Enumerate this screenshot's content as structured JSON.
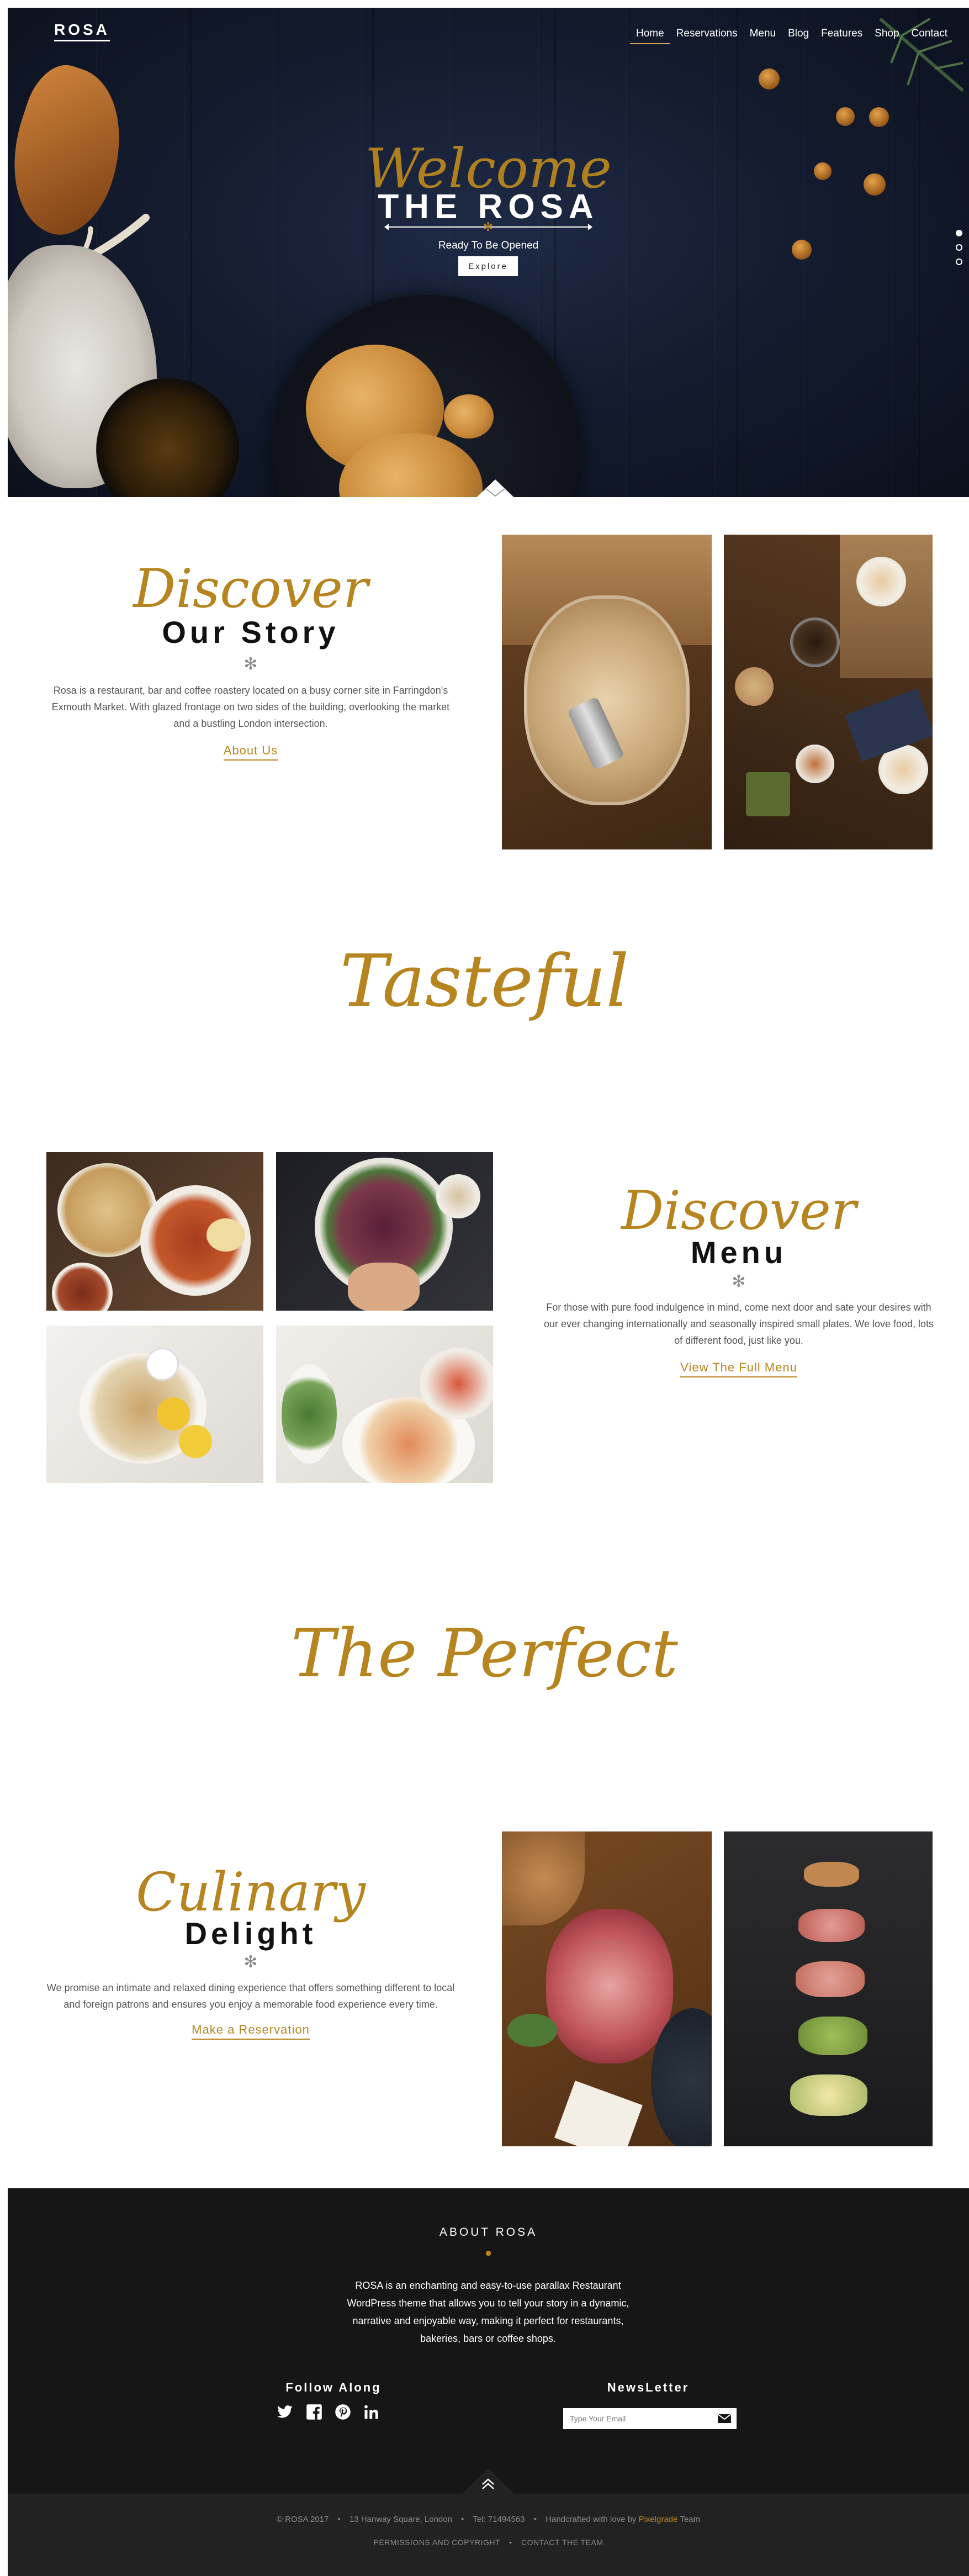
{
  "header": {
    "logo": "ROSA",
    "nav": [
      {
        "label": "Home",
        "active": true
      },
      {
        "label": "Reservations"
      },
      {
        "label": "Menu"
      },
      {
        "label": "Blog"
      },
      {
        "label": "Features"
      },
      {
        "label": "Shop"
      },
      {
        "label": "Contact"
      }
    ]
  },
  "hero": {
    "script": "Welcome",
    "title": "THE ROSA",
    "tagline": "Ready To Be Opened",
    "button": "Explore",
    "slides": 3,
    "active_slide": 1
  },
  "story": {
    "script": "Discover",
    "heading": "Our Story",
    "star": "✻",
    "text": "Rosa is a restaurant, bar and coffee roastery located on a busy corner site in Farringdon's Exmouth Market. With glazed frontage on two sides of the building, overlooking the market and a bustling London intersection.",
    "link": "About Us"
  },
  "tasteful": {
    "script": "Tasteful"
  },
  "menu": {
    "script": "Discover",
    "heading": "Menu",
    "star": "✻",
    "text": "For those with pure food indulgence in mind, come next door and sate your desires with our ever changing internationally and seasonally inspired small plates. We love food, lots of different food, just like you.",
    "link": "View The Full Menu"
  },
  "perfect": {
    "script": "The Perfect"
  },
  "delight": {
    "script": "Culinary",
    "heading": "Delight",
    "star": "✻",
    "text": "We promise an intimate and relaxed dining experience that offers something different to local and foreign patrons and ensures you enjoy a memorable food experience every time.",
    "link": "Make a Reservation"
  },
  "footer": {
    "about_title": "ABOUT ROSA",
    "about_text": "ROSA is an enchanting and easy-to-use parallax Restaurant WordPress theme that allows you to tell your story in a dynamic, narrative and enjoyable way, making it perfect for restaurants, bakeries, bars or coffee shops.",
    "follow_title": "Follow Along",
    "social": [
      "twitter-icon",
      "facebook-icon",
      "pinterest-icon",
      "linkedin-icon"
    ],
    "newsletter_title": "NewsLetter",
    "email_placeholder": "Type Your Email",
    "copyright": "© ROSA 2017",
    "address": "13 Hanway Square, London",
    "phone": "Tel: 71494563",
    "credit_prefix": "Handcrafted with love by",
    "credit_brand": "Pixelgrade",
    "credit_suffix": "Team",
    "links": [
      "PERMISSIONS AND COPYRIGHT",
      "CONTACT THE TEAM"
    ]
  },
  "colors": {
    "accent": "#b7851f",
    "hero_bg": "#141c30",
    "footer_bg": "#161616"
  }
}
